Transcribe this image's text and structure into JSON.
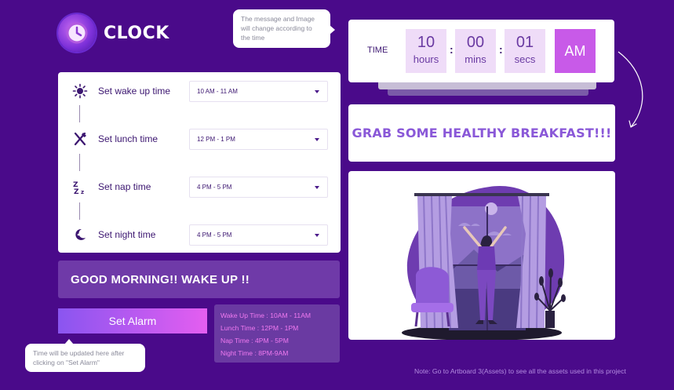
{
  "app": {
    "title": "CLOCK",
    "logo_icon": "clock-icon"
  },
  "tooltips": {
    "image_message": "The message and Image will change according to the time",
    "time_update": "Time will be updated here after clicking on \"Set Alarm\""
  },
  "settings": {
    "items": [
      {
        "icon": "sun-icon",
        "label": "Set wake up time",
        "value": "10 AM - 11 AM"
      },
      {
        "icon": "fork-knife-icon",
        "label": "Set lunch time",
        "value": "12 PM - 1 PM"
      },
      {
        "icon": "zzz-icon",
        "label": "Set nap time",
        "value": "4 PM - 5 PM"
      },
      {
        "icon": "moon-icon",
        "label": "Set night time",
        "value": "4 PM - 5 PM"
      }
    ]
  },
  "banner": {
    "text": "GOOD MORNING!! WAKE UP !!"
  },
  "alarm_button": {
    "label": "Set Alarm"
  },
  "summary": {
    "wake": "Wake Up Time : 10AM - 11AM",
    "lunch": "Lunch Time : 12PM - 1PM",
    "nap": "Nap Time : 4PM - 5PM",
    "night": "Night Time : 8PM-9AM"
  },
  "clock": {
    "label": "TIME",
    "hours": "10",
    "hours_unit": "hours",
    "mins": "00",
    "mins_unit": "mins",
    "secs": "01",
    "secs_unit": "secs",
    "meridiem": "AM"
  },
  "message": {
    "text": "GRAB SOME HEALTHY BREAKFAST!!!"
  },
  "note": "Note: Go to Artboard 3(Assets)  to see all the assets used in this project",
  "colors": {
    "background": "#4a0a8a",
    "accent": "#c85ae8",
    "summary_text": "#f07af0"
  }
}
